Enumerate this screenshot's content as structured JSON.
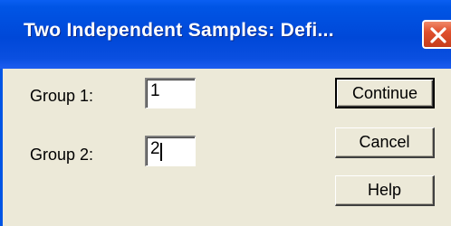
{
  "window": {
    "title": "Two Independent Samples: Defi...",
    "close_icon": "close-icon"
  },
  "form": {
    "group1_label": "Group 1:",
    "group1_value": "1",
    "group2_label": "Group 2:",
    "group2_value": "2"
  },
  "buttons": {
    "continue_label": "Continue",
    "cancel_label": "Cancel",
    "help_label": "Help"
  },
  "colors": {
    "titlebar": "#0048d8",
    "close_button": "#e0502e",
    "dialog_background": "#ece9d8"
  }
}
